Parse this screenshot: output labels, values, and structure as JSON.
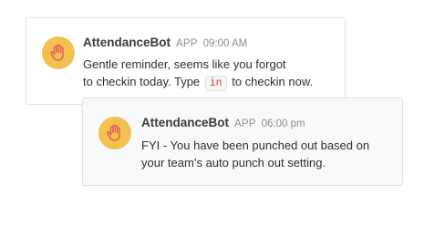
{
  "colors": {
    "avatar_bg": "#f3c14e",
    "hand_icon": "#e45b5b",
    "code_text": "#d23c4f"
  },
  "messages": [
    {
      "bot_name": "AttendanceBot",
      "app_tag": "APP",
      "time": "09:00 AM",
      "avatar_icon": "raised-hand-icon",
      "line1": "Gentle reminder, seems like you forgot",
      "line2_before": "to checkin today. Type",
      "code": "in",
      "line2_after": "to checkin now."
    },
    {
      "bot_name": "AttendanceBot",
      "app_tag": "APP",
      "time": "06:00 pm",
      "avatar_icon": "raised-hand-icon",
      "line1": "FYI - You have been punched out based on",
      "line2": "your team’s auto punch out setting."
    }
  ]
}
